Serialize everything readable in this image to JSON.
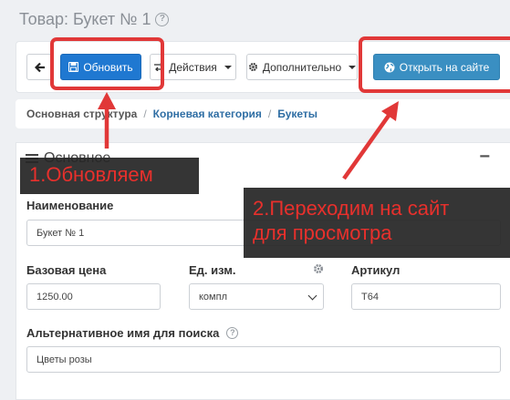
{
  "page": {
    "title": "Товар: Букет № 1"
  },
  "toolbar": {
    "update_label": "Обновить",
    "actions_label": "Действия",
    "more_label": "Дополнительно",
    "open_site_label": "Открыть на сайте"
  },
  "breadcrumb": {
    "items": [
      "Основная структура",
      "Корневая категория",
      "Букеты"
    ]
  },
  "section": {
    "title": "Основное",
    "collapse_symbol": "−"
  },
  "form": {
    "name_label": "Наименование",
    "name_value": "Букет № 1",
    "price_label": "Базовая цена",
    "price_value": "1250.00",
    "unit_label": "Ед. изм.",
    "unit_value": "компл",
    "sku_label": "Артикул",
    "sku_value": "Т64",
    "alt_name_label": "Альтернативное имя для поиска",
    "alt_name_value": "Цветы розы"
  },
  "annotations": {
    "step1": "1.Обновляем",
    "step2_line1": "2.Переходим на сайт",
    "step2_line2": "для просмотра",
    "color": "#e13838"
  }
}
